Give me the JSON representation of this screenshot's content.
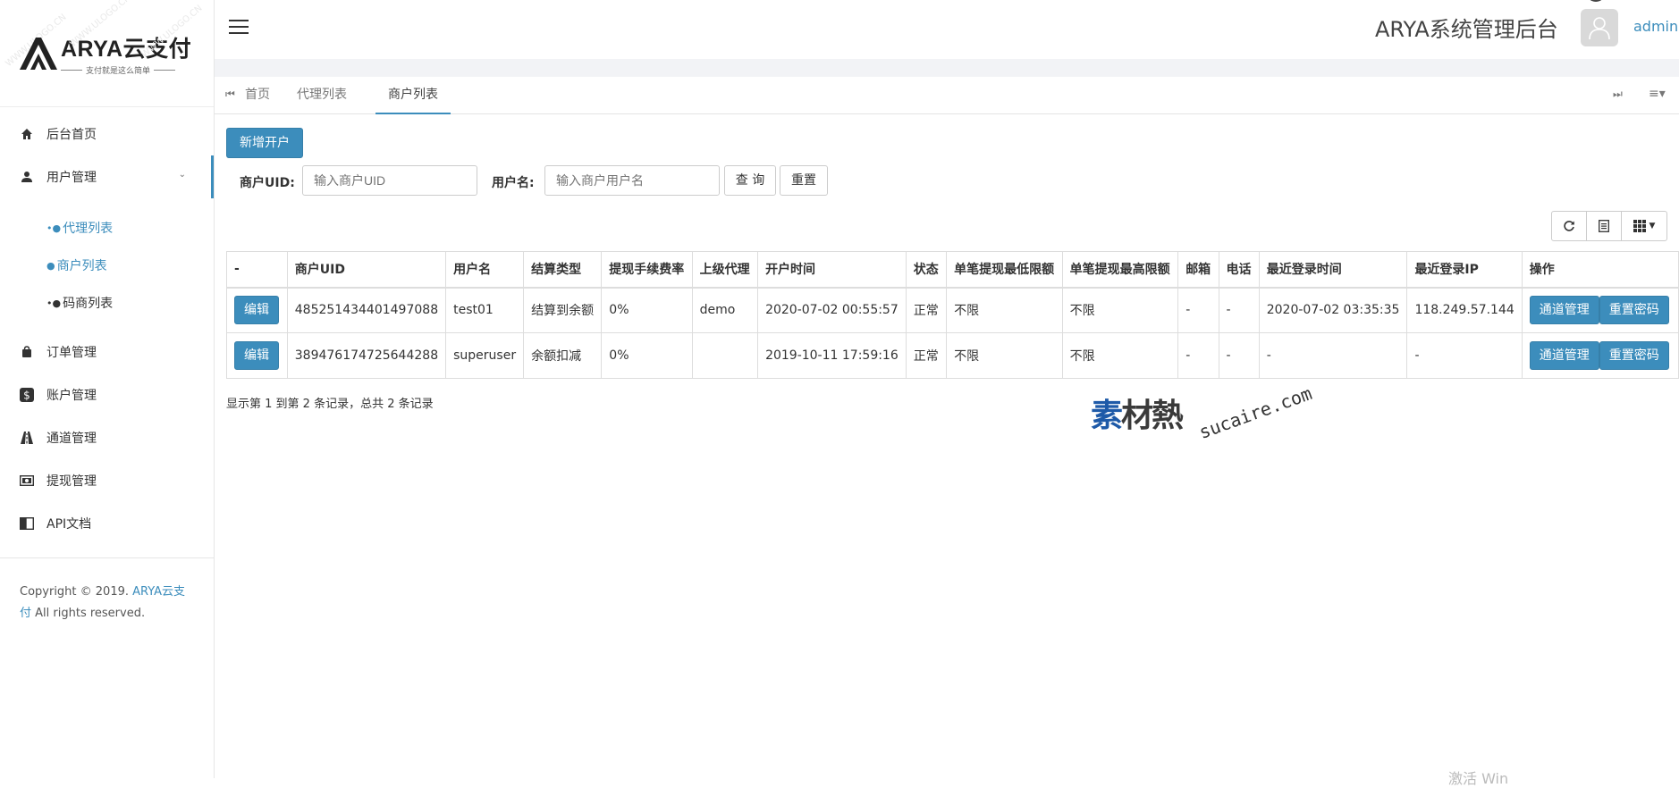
{
  "brand": {
    "logo_title": "ARYA云支付",
    "logo_sub": "支付就是这么简单",
    "watermark": "WWW.ULOGO.CN"
  },
  "sidebar": {
    "items": [
      {
        "label": "后台首页",
        "icon": "home-icon"
      },
      {
        "label": "用户管理",
        "icon": "user-icon",
        "expanded": true
      },
      {
        "label": "订单管理",
        "icon": "bag-icon"
      },
      {
        "label": "账户管理",
        "icon": "dollar-icon"
      },
      {
        "label": "通道管理",
        "icon": "road-icon"
      },
      {
        "label": "提现管理",
        "icon": "money-icon"
      },
      {
        "label": "API文档",
        "icon": "book-icon"
      }
    ],
    "sub_items": [
      {
        "label": "代理列表"
      },
      {
        "label": "商户列表"
      },
      {
        "label": "码商列表"
      }
    ],
    "footer_prefix": "Copyright © 2019. ",
    "footer_brand": "ARYA云支付",
    "footer_suffix": " All rights reserved."
  },
  "header": {
    "title": "ARYA系统管理后台",
    "user": "admin"
  },
  "tabs": [
    {
      "label": "首页"
    },
    {
      "label": "代理列表"
    },
    {
      "label": "商户列表",
      "active": true
    }
  ],
  "toolbar": {
    "add_label": "新增开户",
    "uid_label": "商户UID:",
    "uid_placeholder": "输入商户UID",
    "name_label": "用户名:",
    "name_placeholder": "输入商户用户名",
    "search_label": "查 询",
    "reset_label": "重置"
  },
  "table": {
    "headers": [
      "-",
      "商户UID",
      "用户名",
      "结算类型",
      "提现手续费率",
      "上级代理",
      "开户时间",
      "状态",
      "单笔提现最低限额",
      "单笔提现最高限额",
      "邮箱",
      "电话",
      "最近登录时间",
      "最近登录IP",
      "操作"
    ],
    "rows": [
      {
        "edit": "编辑",
        "uid": "485251434401497088",
        "username": "test01",
        "settle": "结算到余额",
        "fee": "0%",
        "agent": "demo",
        "created": "2020-07-02 00:55:57",
        "status": "正常",
        "min": "不限",
        "max": "不限",
        "email": "-",
        "phone": "-",
        "last_login": "2020-07-02 03:35:35",
        "last_ip": "118.249.57.144",
        "act1": "通道管理",
        "act2": "重置密码"
      },
      {
        "edit": "编辑",
        "uid": "389476174725644288",
        "username": "superuser",
        "settle": "余额扣减",
        "fee": "0%",
        "agent": "",
        "created": "2019-10-11 17:59:16",
        "status": "正常",
        "min": "不限",
        "max": "不限",
        "email": "-",
        "phone": "-",
        "last_login": "-",
        "last_ip": "-",
        "act1": "通道管理",
        "act2": "重置密码"
      }
    ],
    "summary": "显示第 1 到第 2 条记录，总共 2 条记录"
  },
  "watermark": {
    "cn_1": "素",
    "cn_2": "材熱",
    "en": "sucaire.com"
  },
  "corner_text": "激活 Win",
  "colors": {
    "accent": "#3c8dbc"
  }
}
